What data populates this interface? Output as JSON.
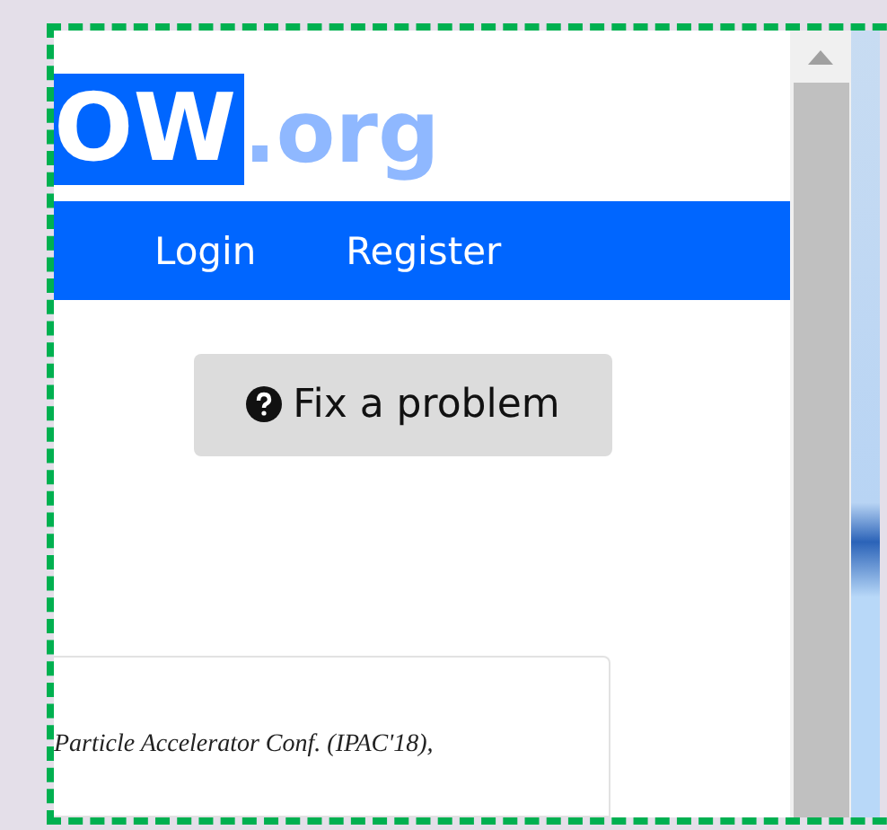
{
  "logo": {
    "mark": "OW",
    "suffix": ".org"
  },
  "nav": [
    {
      "label": "Login"
    },
    {
      "label": "Register"
    }
  ],
  "fix_button": {
    "label": "Fix a problem"
  },
  "citation": {
    "text": "Particle Accelerator Conf. (IPAC'18),"
  }
}
